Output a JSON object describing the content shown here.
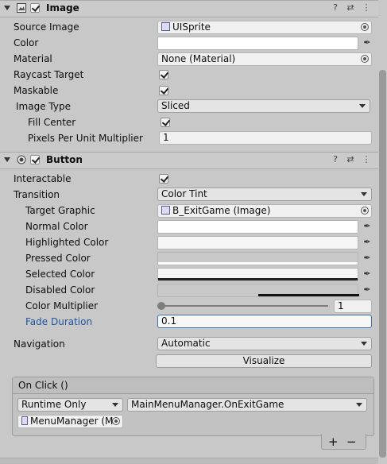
{
  "image_component": {
    "title": "Image",
    "fields": {
      "source_image": {
        "label": "Source Image",
        "value": "UISprite"
      },
      "color": {
        "label": "Color"
      },
      "material": {
        "label": "Material",
        "value": "None (Material)"
      },
      "raycast_target": {
        "label": "Raycast Target",
        "checked": true
      },
      "maskable": {
        "label": "Maskable",
        "checked": true
      },
      "image_type": {
        "label": "Image Type",
        "value": "Sliced"
      },
      "fill_center": {
        "label": "Fill Center",
        "checked": true
      },
      "ppu_multiplier": {
        "label": "Pixels Per Unit Multiplier",
        "value": "1"
      }
    }
  },
  "button_component": {
    "title": "Button",
    "fields": {
      "interactable": {
        "label": "Interactable",
        "checked": true
      },
      "transition": {
        "label": "Transition",
        "value": "Color Tint"
      },
      "target_graphic": {
        "label": "Target Graphic",
        "value": "B_ExitGame (Image)"
      },
      "normal_color": {
        "label": "Normal Color"
      },
      "highlighted_color": {
        "label": "Highlighted Color"
      },
      "pressed_color": {
        "label": "Pressed Color"
      },
      "selected_color": {
        "label": "Selected Color"
      },
      "disabled_color": {
        "label": "Disabled Color"
      },
      "color_multiplier": {
        "label": "Color Multiplier",
        "value": "1",
        "slider_level": 0
      },
      "fade_duration": {
        "label": "Fade Duration",
        "value": "0.1"
      },
      "navigation": {
        "label": "Navigation",
        "value": "Automatic"
      },
      "visualize": {
        "label": "Visualize"
      }
    },
    "on_click": {
      "title": "On Click ()",
      "runtime": "Runtime Only",
      "function": "MainMenuManager.OnExitGame",
      "object": "MenuManager (M",
      "add": "+",
      "remove": "−"
    }
  },
  "header_icons": {
    "help": "?",
    "preset": "⇄",
    "menu": "⋮"
  },
  "colors": {
    "panel": "#c8c8c8",
    "header": "#cbcbcb",
    "focus_border": "#3a72b0",
    "label_highlight": "#1e56a0"
  }
}
